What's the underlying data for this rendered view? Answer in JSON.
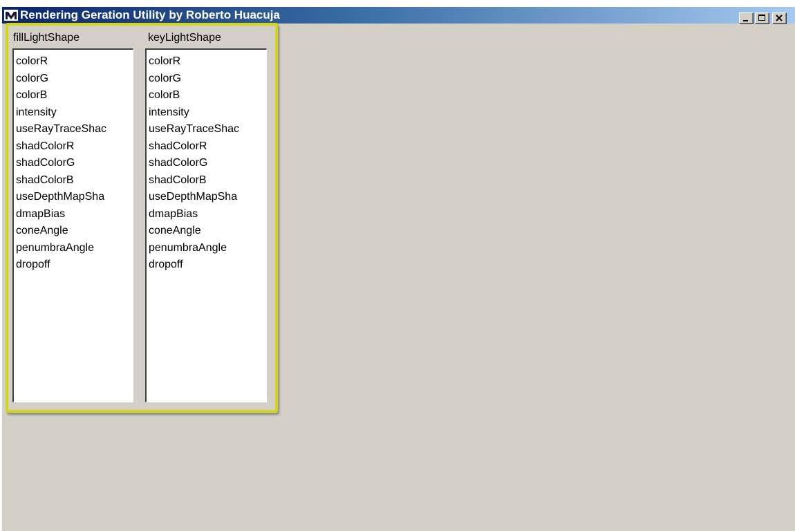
{
  "window": {
    "title": "Rendering Geration Utility by Roberto Huacuja",
    "app_icon": "maya-icon"
  },
  "controls": {
    "minimize_icon": "minimize-icon",
    "maximize_icon": "maximize-icon",
    "close_icon": "close-icon"
  },
  "columns": [
    {
      "header": "fillLightShape",
      "items": [
        "colorR",
        "colorG",
        "colorB",
        "intensity",
        "useRayTraceShac",
        "shadColorR",
        "shadColorG",
        "shadColorB",
        "useDepthMapSha",
        "dmapBias",
        "coneAngle",
        "penumbraAngle",
        "dropoff"
      ]
    },
    {
      "header": "keyLightShape",
      "items": [
        "colorR",
        "colorG",
        "colorB",
        "intensity",
        "useRayTraceShac",
        "shadColorR",
        "shadColorG",
        "shadColorB",
        "useDepthMapSha",
        "dmapBias",
        "coneAngle",
        "penumbraAngle",
        "dropoff"
      ]
    }
  ],
  "colors": {
    "window_bg": "#d4d0c8",
    "title_gradient_start": "#0a246a",
    "title_gradient_end": "#a6caf0",
    "highlight": "#d2d619"
  }
}
